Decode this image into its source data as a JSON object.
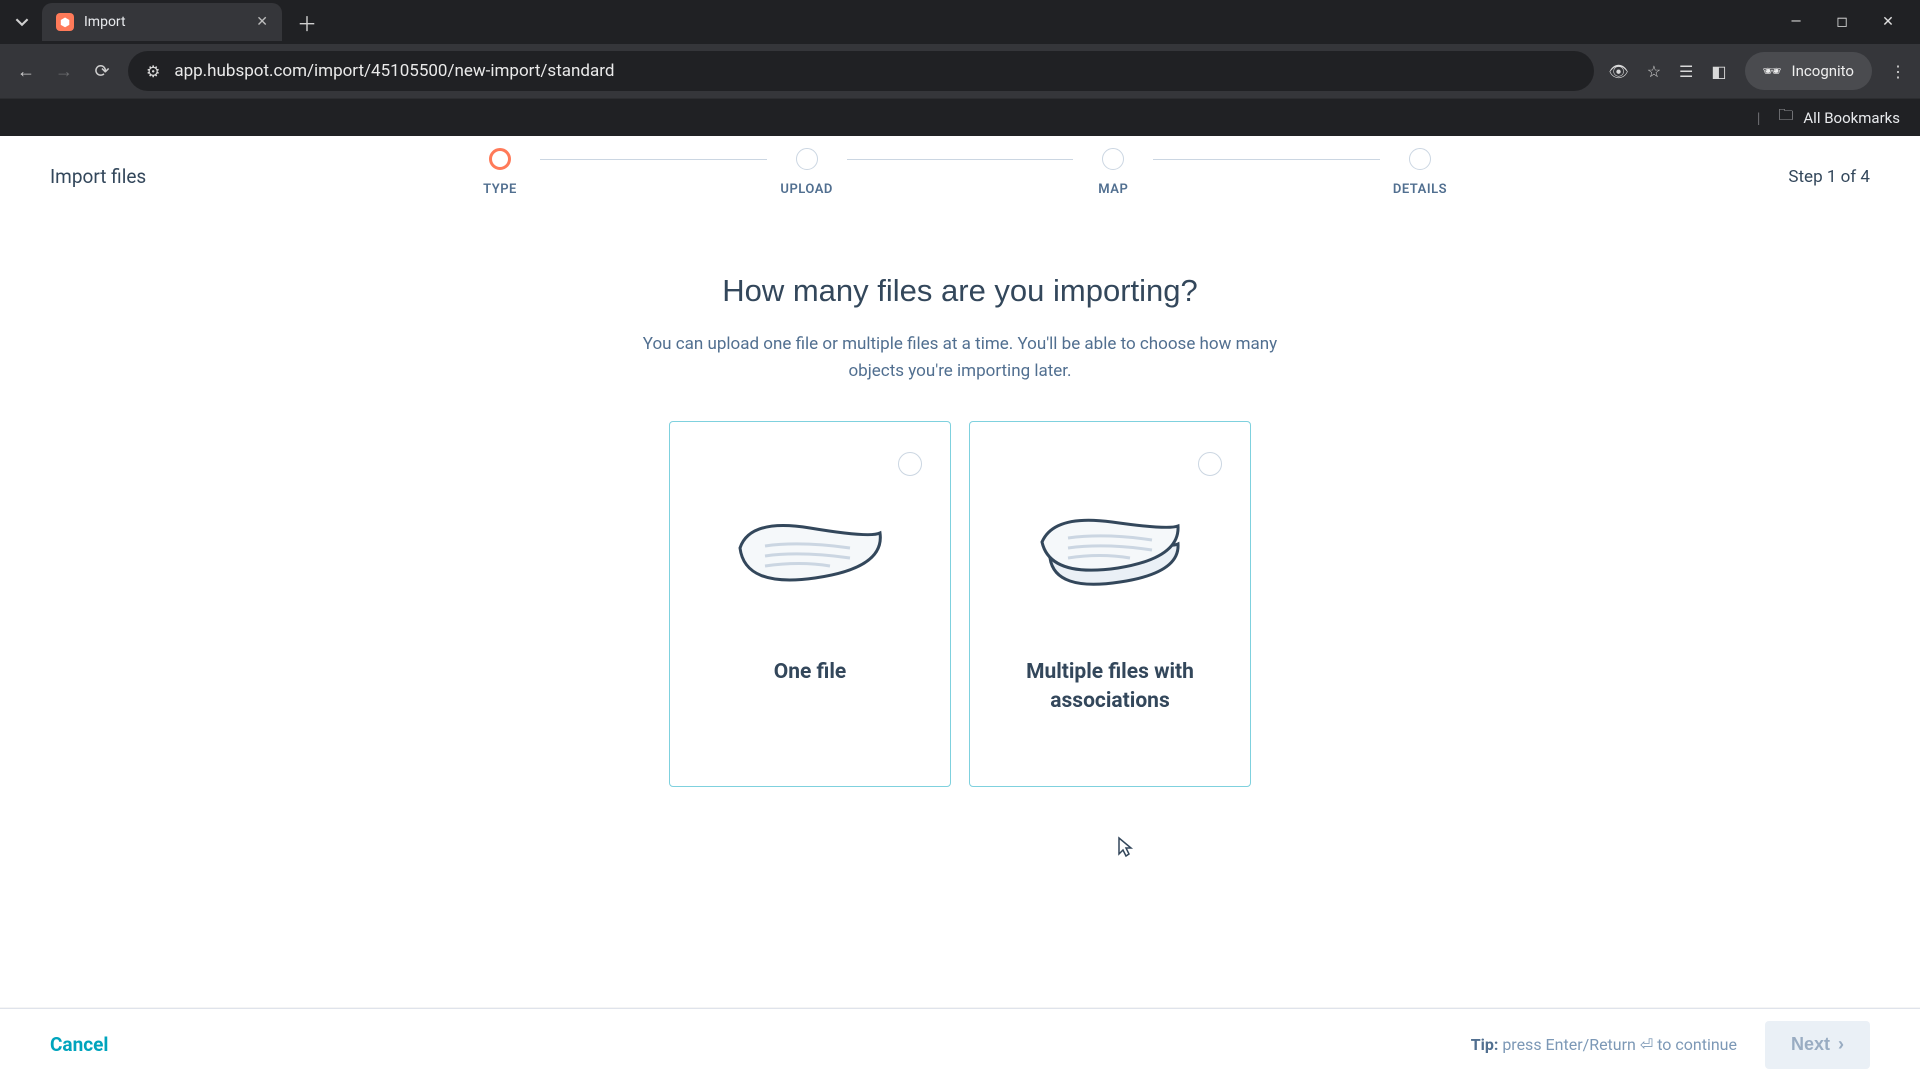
{
  "browser": {
    "tab_title": "Import",
    "url": "app.hubspot.com/import/45105500/new-import/standard",
    "incognito_label": "Incognito",
    "all_bookmarks": "All Bookmarks"
  },
  "header": {
    "page_title": "Import files",
    "step_counter": "Step 1 of 4"
  },
  "stepper": {
    "steps": [
      {
        "label": "TYPE",
        "active": true
      },
      {
        "label": "UPLOAD",
        "active": false
      },
      {
        "label": "MAP",
        "active": false
      },
      {
        "label": "DETAILS",
        "active": false
      }
    ]
  },
  "heading": "How many files are you importing?",
  "subtext": "You can upload one file or multiple files at a time. You'll be able to choose how many objects you're importing later.",
  "cards": [
    {
      "label": "One file"
    },
    {
      "label": "Multiple files with associations"
    }
  ],
  "footer": {
    "cancel": "Cancel",
    "tip_prefix": "Tip:",
    "tip_text": "press Enter/Return ⏎ to continue",
    "next": "Next"
  }
}
